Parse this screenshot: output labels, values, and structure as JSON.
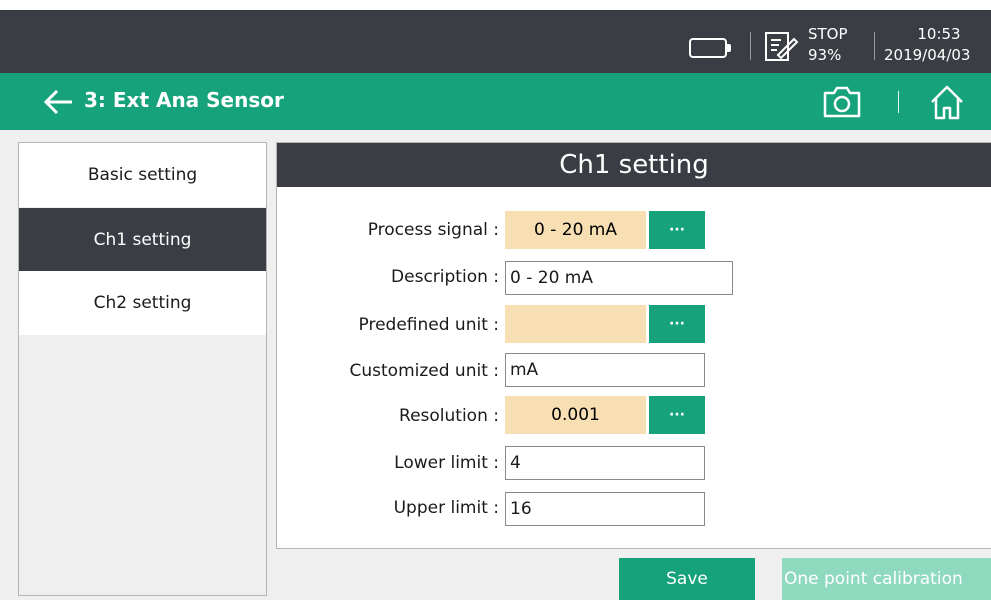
{
  "status": {
    "stop": "STOP",
    "percent": "93%",
    "time": "10:53",
    "date": "2019/04/03"
  },
  "header": {
    "title": "3: Ext Ana Sensor",
    "icons": [
      "back-arrow-icon",
      "camera-icon",
      "home-icon"
    ]
  },
  "sidebar": {
    "items": [
      {
        "label": "Basic setting",
        "active": false
      },
      {
        "label": "Ch1 setting",
        "active": true
      },
      {
        "label": "Ch2 setting",
        "active": false
      }
    ]
  },
  "panel": {
    "title": "Ch1 setting",
    "process_signal": {
      "label": "Process signal :",
      "value": "0 - 20 mA",
      "more": "···"
    },
    "description": {
      "label": "Description :",
      "value": "0 - 20 mA"
    },
    "predefined_unit": {
      "label": "Predefined unit :",
      "value": "",
      "more": "···"
    },
    "customized_unit": {
      "label": "Customized unit :",
      "value": "mA"
    },
    "resolution": {
      "label": "Resolution :",
      "value": "0.001",
      "more": "···"
    },
    "lower_limit": {
      "label": "Lower limit :",
      "value": "4"
    },
    "upper_limit": {
      "label": "Upper limit :",
      "value": "16"
    }
  },
  "buttons": {
    "save": "Save",
    "calibration": "One point calibration"
  },
  "colors": {
    "accent": "#16a37b",
    "dark": "#3b3d44",
    "select_bg": "#f7deb3",
    "disabled_accent": "#8fd9bf"
  }
}
